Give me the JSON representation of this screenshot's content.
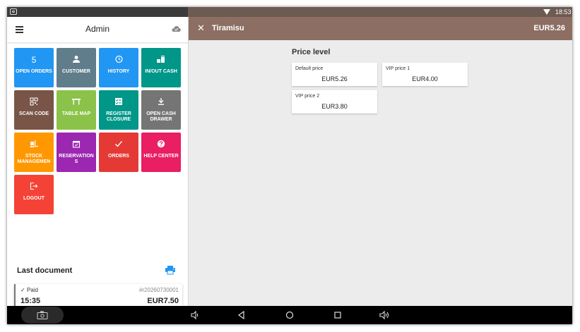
{
  "status_bar": {
    "time": "18:53"
  },
  "sidebar": {
    "title": "Admin",
    "tiles": [
      {
        "label": "OPEN ORDERS",
        "icon_text": "5",
        "color": "#2196f3"
      },
      {
        "label": "CUSTOMER",
        "icon": "person-icon",
        "color": "#607d8b"
      },
      {
        "label": "HISTORY",
        "icon": "history-icon",
        "color": "#2196f3"
      },
      {
        "label": "IN/OUT CASH",
        "icon": "cash-icon",
        "color": "#009688"
      },
      {
        "label": "SCAN CODE",
        "icon": "qr-code-icon",
        "color": "#795548"
      },
      {
        "label": "TABLE MAP",
        "icon": "table-icon",
        "color": "#8bc34a"
      },
      {
        "label": "REGISTER CLOSURE",
        "icon": "checklist-icon",
        "color": "#009688"
      },
      {
        "label": "OPEN CASH DRAWER",
        "icon": "download-icon",
        "color": "#757575"
      },
      {
        "label": "STOCK MANAGEMEN",
        "icon": "forklift-icon",
        "color": "#ff9800"
      },
      {
        "label": "RESERVATION S",
        "icon": "calendar-icon",
        "color": "#9c27b0"
      },
      {
        "label": "ORDERS",
        "icon": "check-icon",
        "color": "#e53935"
      },
      {
        "label": "HELP CENTER",
        "icon": "help-icon",
        "color": "#e91e63"
      },
      {
        "label": "LOGOUT",
        "icon": "logout-icon",
        "color": "#f44336"
      }
    ]
  },
  "last_document": {
    "title": "Last document",
    "status": "Paid",
    "number": "#r20260730001",
    "time": "15:35",
    "total": "EUR7.50"
  },
  "product": {
    "name": "Tiramisu",
    "price": "EUR5.26"
  },
  "price_level": {
    "title": "Price level",
    "options": [
      {
        "label": "Default price",
        "value": "EUR5.26"
      },
      {
        "label": "VIP price 1",
        "value": "EUR4.00"
      },
      {
        "label": "VIP price 2",
        "value": "EUR3.80"
      }
    ]
  },
  "colors": {
    "header_brown": "#8d6e63",
    "status_bar": "#6d5a52",
    "accent_blue": "#2196f3"
  }
}
